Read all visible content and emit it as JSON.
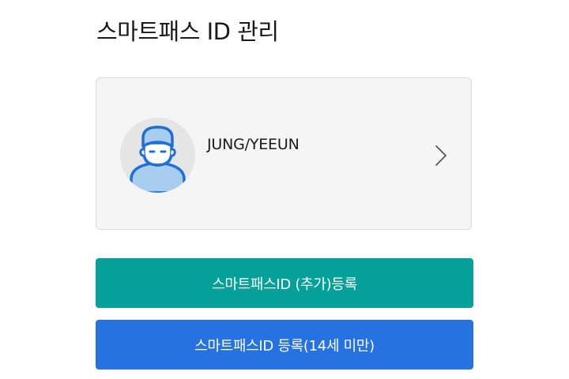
{
  "header": {
    "title": "스마트패스 ID 관리"
  },
  "profile": {
    "name": "JUNG/YEEUN",
    "avatar_icon": "person-avatar-icon",
    "chevron_icon": "chevron-right-icon"
  },
  "actions": {
    "add_register_label": "스마트패스ID (추가)등록",
    "register_minor_label": "스마트패스ID 등록(14세 미만)"
  },
  "colors": {
    "teal_button": "#05a09a",
    "blue_button": "#2672e2",
    "card_background": "#f5f5f5",
    "avatar_stroke": "#1f6fd6",
    "avatar_fill": "#a9cdef"
  }
}
